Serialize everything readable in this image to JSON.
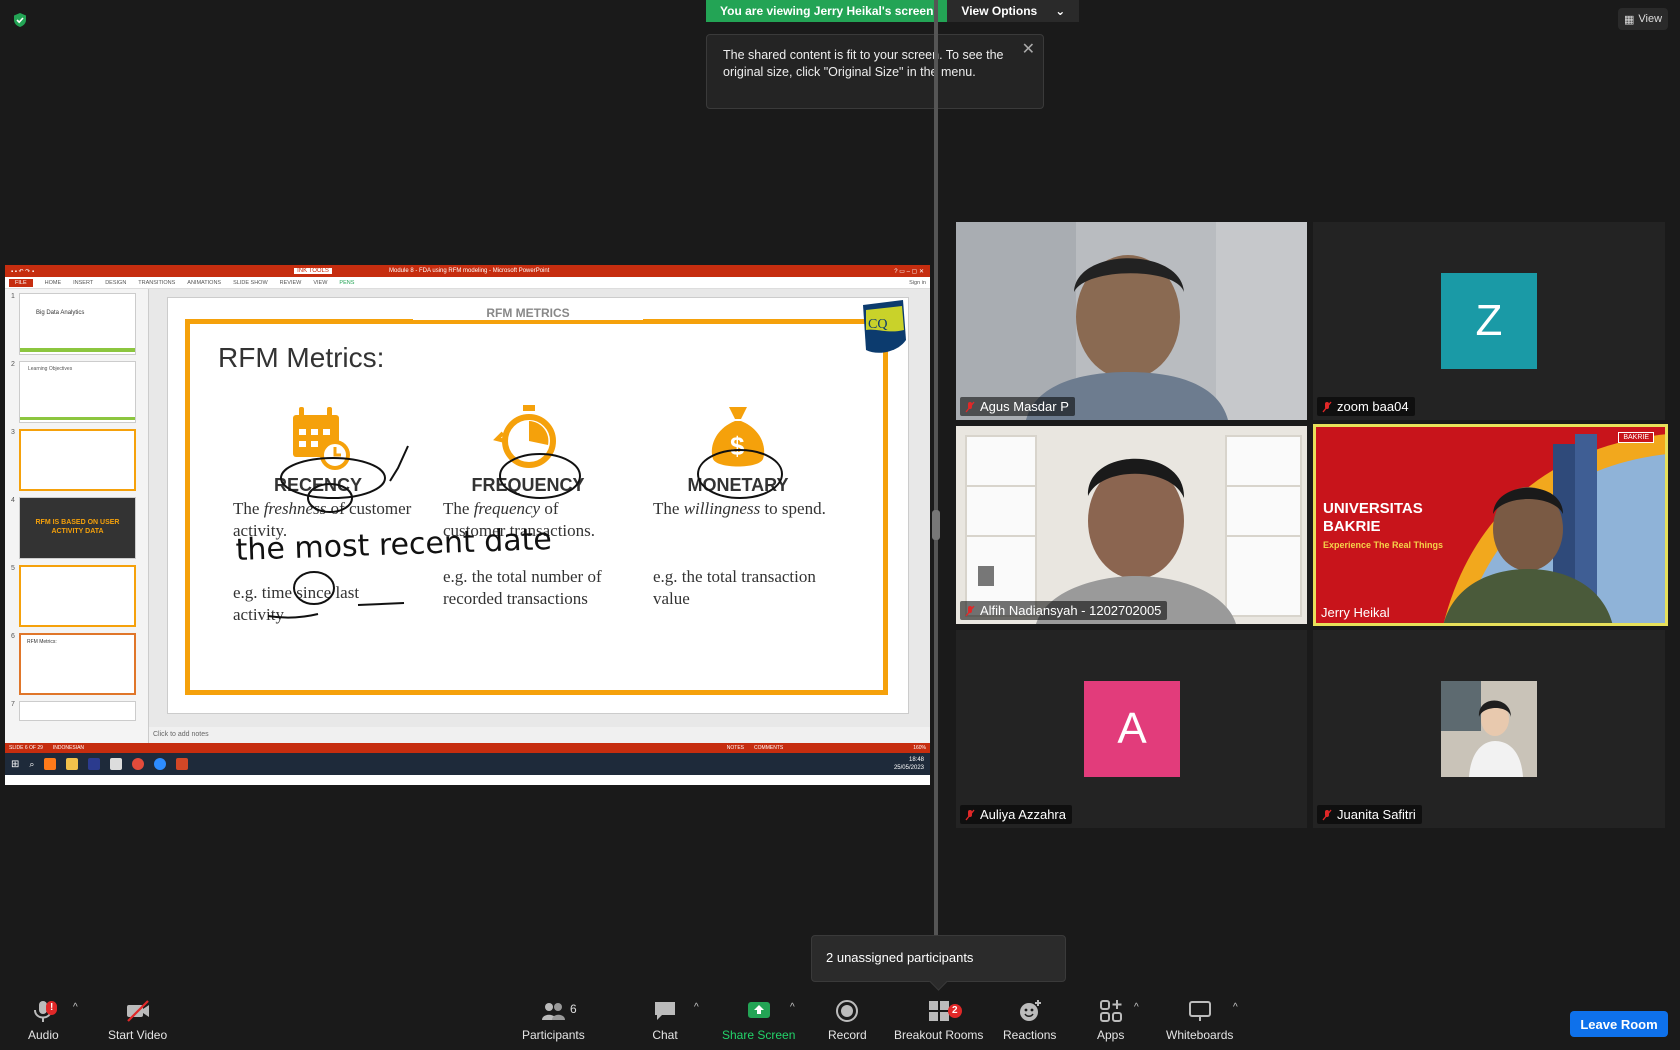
{
  "banner": {
    "viewing_text": "You are viewing Jerry Heikal's screen",
    "view_options_label": "View Options",
    "notice_text": "The shared content is fit to your screen. To see the original size, click \"Original Size\" in the menu.",
    "view_label": "View"
  },
  "shared_screen": {
    "ppt_title": "Module 8 - FDA using RFM modeling - Microsoft PowerPoint",
    "ink_tools": "INK TOOLS",
    "ribbon_tabs": [
      "FILE",
      "HOME",
      "INSERT",
      "DESIGN",
      "TRANSITIONS",
      "ANIMATIONS",
      "SLIDE SHOW",
      "REVIEW",
      "VIEW",
      "PENS"
    ],
    "sign_in": "Sign in",
    "thumbnails": [
      {
        "num": "1",
        "text": "Big Data Analytics"
      },
      {
        "num": "2",
        "text": "Learning Objectives"
      },
      {
        "num": "3",
        "text": ""
      },
      {
        "num": "4",
        "text": "RFM IS BASED ON USER ACTIVITY DATA"
      },
      {
        "num": "5",
        "text": ""
      },
      {
        "num": "6",
        "text": "RFM Metrics:"
      },
      {
        "num": "7",
        "text": ""
      }
    ],
    "slide": {
      "header": "RFM METRICS",
      "title": "RFM Metrics:",
      "metrics": [
        {
          "name": "RECENCY",
          "desc_pre": "The ",
          "desc_em": "freshness",
          "desc_post": " of customer activity.",
          "example": "e.g. time since last activity"
        },
        {
          "name": "FREQUENCY",
          "desc_pre": "The ",
          "desc_em": "frequency",
          "desc_post": " of customer transactions.",
          "example": "e.g. the total number of recorded transactions"
        },
        {
          "name": "MONETARY",
          "desc_pre": "The ",
          "desc_em": "willingness",
          "desc_post": " to spend.",
          "example": "e.g. the total transaction value"
        }
      ],
      "handwriting": "the most recent date"
    },
    "notes_placeholder": "Click to add notes",
    "status": {
      "slide_count": "SLIDE 6 OF 29",
      "language": "INDONESIAN",
      "notes": "NOTES",
      "comments": "COMMENTS",
      "zoom": "160%"
    },
    "clock": {
      "time": "18:48",
      "date": "25/05/2023"
    }
  },
  "participants": [
    {
      "name": "Agus Masdar P",
      "muted": true,
      "type": "video"
    },
    {
      "name": "zoom baa04",
      "muted": true,
      "type": "avatar",
      "letter": "Z"
    },
    {
      "name": "Alfih Nadiansyah - 1202702005",
      "muted": true,
      "type": "video"
    },
    {
      "name": "Jerry Heikal",
      "muted": false,
      "type": "video",
      "active": true,
      "banner_line1": "UNIVERSITAS",
      "banner_line2": "BAKRIE",
      "banner_tagline": "Experience The Real Things",
      "banner_logo": "BAKRIE"
    },
    {
      "name": "Auliya Azzahra",
      "muted": true,
      "type": "avatar",
      "letter": "A"
    },
    {
      "name": "Juanita Safitri",
      "muted": true,
      "type": "photo"
    }
  ],
  "unassigned_text": "2 unassigned participants",
  "toolbar": {
    "audio": "Audio",
    "audio_badge": "!",
    "start_video": "Start Video",
    "participants": "Participants",
    "participants_count": "6",
    "chat": "Chat",
    "share_screen": "Share Screen",
    "record": "Record",
    "breakout_rooms": "Breakout Rooms",
    "breakout_badge": "2",
    "reactions": "Reactions",
    "apps": "Apps",
    "whiteboards": "Whiteboards",
    "leave_room": "Leave Room"
  },
  "colors": {
    "zoom_green": "#23a455",
    "leave_blue": "#0e71eb",
    "ppt_red": "#c62d0f",
    "slide_orange": "#f5a10b",
    "avatar_teal": "#1a9aa6",
    "avatar_pink": "#e23c7b",
    "active_speaker": "#e7e05a"
  }
}
